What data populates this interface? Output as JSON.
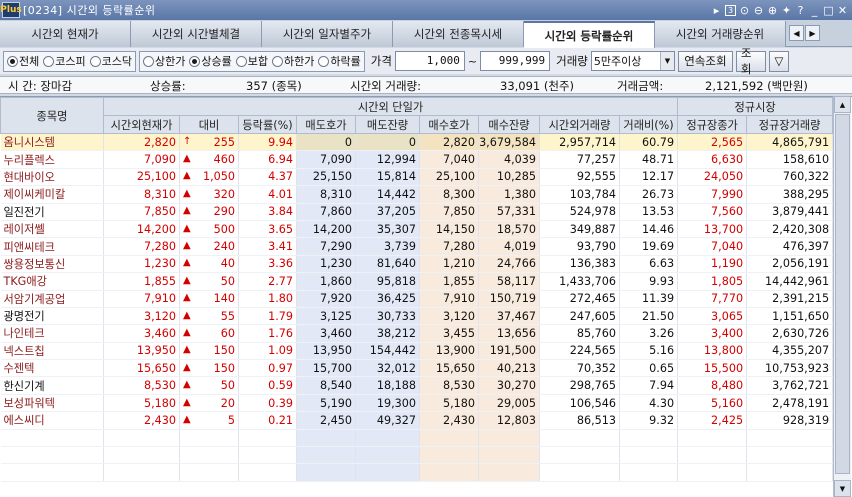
{
  "window": {
    "logo": "Plus",
    "title": "[0234] 시간외 등락률순위",
    "ctrl_num": "3",
    "icons": [
      "page-left-icon",
      "number-box-icon",
      "search-icon",
      "zoom-out-icon",
      "zoom-in-icon",
      "pin-icon",
      "help-icon",
      "minimize-icon",
      "maximize-icon",
      "close-icon"
    ]
  },
  "tabs": [
    {
      "label": "시간외 현재가"
    },
    {
      "label": "시간외 시간별체결"
    },
    {
      "label": "시간외 일자별주가"
    },
    {
      "label": "시간외 전종목시세"
    },
    {
      "label": "시간외 등락률순위",
      "active": true
    },
    {
      "label": "시간외 거래량순위"
    }
  ],
  "filters": {
    "market": [
      {
        "label": "전체",
        "checked": true
      },
      {
        "label": "코스피",
        "checked": false
      },
      {
        "label": "코스닥",
        "checked": false
      }
    ],
    "direction": [
      {
        "label": "상한가",
        "checked": false
      },
      {
        "label": "상승률",
        "checked": true
      },
      {
        "label": "보합",
        "checked": false
      },
      {
        "label": "하한가",
        "checked": false
      },
      {
        "label": "하락률",
        "checked": false
      }
    ],
    "price_label": "가격",
    "price_from": "1,000",
    "tilde": "~",
    "price_to": "999,999",
    "volume_label": "거래량",
    "volume_selected": "5만주이상",
    "continuous_btn": "연속조회",
    "query_btn": "조회"
  },
  "info": {
    "time_label": "시  간: 장마감",
    "rise_label": "상승률:",
    "rise_count": "357 (종목)",
    "volume_label": "시간외 거래량:",
    "volume_value": "33,091 (천주)",
    "amount_label": "거래금액:",
    "amount_value": "2,121,592 (백만원)"
  },
  "grid": {
    "header_group_after": "시간외 단일가",
    "header_group_regular": "정규시장",
    "columns": [
      "종목명",
      "시간외현재가",
      "대비",
      "등락률(%)",
      "매도호가",
      "매도잔량",
      "매수호가",
      "매수잔량",
      "시간외거래량",
      "거래비(%)",
      "정규장종가",
      "정규장거래량"
    ],
    "rows": [
      {
        "name": "옴니시스템",
        "price": "2,820",
        "arrow": "↑",
        "change": "255",
        "rate": "9.94",
        "ask": "0",
        "ask_qty": "0",
        "bid": "2,820",
        "bid_qty": "3,679,584",
        "vol": "2,957,714",
        "vol_ratio": "60.79",
        "close": "2,565",
        "close_vol": "4,865,791",
        "name_dark": false
      },
      {
        "name": "누리플렉스",
        "price": "7,090",
        "arrow": "▲",
        "change": "460",
        "rate": "6.94",
        "ask": "7,090",
        "ask_qty": "12,994",
        "bid": "7,040",
        "bid_qty": "4,039",
        "vol": "77,257",
        "vol_ratio": "48.71",
        "close": "6,630",
        "close_vol": "158,610",
        "name_dark": false
      },
      {
        "name": "현대바이오",
        "price": "25,100",
        "arrow": "▲",
        "change": "1,050",
        "rate": "4.37",
        "ask": "25,150",
        "ask_qty": "15,814",
        "bid": "25,100",
        "bid_qty": "10,285",
        "vol": "92,555",
        "vol_ratio": "12.17",
        "close": "24,050",
        "close_vol": "760,322",
        "name_dark": false
      },
      {
        "name": "제이씨케미칼",
        "price": "8,310",
        "arrow": "▲",
        "change": "320",
        "rate": "4.01",
        "ask": "8,310",
        "ask_qty": "14,442",
        "bid": "8,300",
        "bid_qty": "1,380",
        "vol": "103,784",
        "vol_ratio": "26.73",
        "close": "7,990",
        "close_vol": "388,295",
        "name_dark": false
      },
      {
        "name": "일진전기",
        "price": "7,850",
        "arrow": "▲",
        "change": "290",
        "rate": "3.84",
        "ask": "7,860",
        "ask_qty": "37,205",
        "bid": "7,850",
        "bid_qty": "57,331",
        "vol": "524,978",
        "vol_ratio": "13.53",
        "close": "7,560",
        "close_vol": "3,879,441",
        "name_dark": true
      },
      {
        "name": "레이저쎌",
        "price": "14,200",
        "arrow": "▲",
        "change": "500",
        "rate": "3.65",
        "ask": "14,200",
        "ask_qty": "35,307",
        "bid": "14,150",
        "bid_qty": "18,570",
        "vol": "349,887",
        "vol_ratio": "14.46",
        "close": "13,700",
        "close_vol": "2,420,308",
        "name_dark": false
      },
      {
        "name": "피앤씨테크",
        "price": "7,280",
        "arrow": "▲",
        "change": "240",
        "rate": "3.41",
        "ask": "7,290",
        "ask_qty": "3,739",
        "bid": "7,280",
        "bid_qty": "4,019",
        "vol": "93,790",
        "vol_ratio": "19.69",
        "close": "7,040",
        "close_vol": "476,397",
        "name_dark": false
      },
      {
        "name": "쌍용정보통신",
        "price": "1,230",
        "arrow": "▲",
        "change": "40",
        "rate": "3.36",
        "ask": "1,230",
        "ask_qty": "81,640",
        "bid": "1,210",
        "bid_qty": "24,766",
        "vol": "136,383",
        "vol_ratio": "6.63",
        "close": "1,190",
        "close_vol": "2,056,191",
        "name_dark": false
      },
      {
        "name": "TKG애강",
        "price": "1,855",
        "arrow": "▲",
        "change": "50",
        "rate": "2.77",
        "ask": "1,860",
        "ask_qty": "95,818",
        "bid": "1,855",
        "bid_qty": "58,117",
        "vol": "1,433,706",
        "vol_ratio": "9.93",
        "close": "1,805",
        "close_vol": "14,442,961",
        "name_dark": false
      },
      {
        "name": "서암기계공업",
        "price": "7,910",
        "arrow": "▲",
        "change": "140",
        "rate": "1.80",
        "ask": "7,920",
        "ask_qty": "36,425",
        "bid": "7,910",
        "bid_qty": "150,719",
        "vol": "272,465",
        "vol_ratio": "11.39",
        "close": "7,770",
        "close_vol": "2,391,215",
        "name_dark": false
      },
      {
        "name": "광명전기",
        "price": "3,120",
        "arrow": "▲",
        "change": "55",
        "rate": "1.79",
        "ask": "3,125",
        "ask_qty": "30,733",
        "bid": "3,120",
        "bid_qty": "37,467",
        "vol": "247,605",
        "vol_ratio": "21.50",
        "close": "3,065",
        "close_vol": "1,151,650",
        "name_dark": true
      },
      {
        "name": "나인테크",
        "price": "3,460",
        "arrow": "▲",
        "change": "60",
        "rate": "1.76",
        "ask": "3,460",
        "ask_qty": "38,212",
        "bid": "3,455",
        "bid_qty": "13,656",
        "vol": "85,760",
        "vol_ratio": "3.26",
        "close": "3,400",
        "close_vol": "2,630,726",
        "name_dark": false
      },
      {
        "name": "넥스트칩",
        "price": "13,950",
        "arrow": "▲",
        "change": "150",
        "rate": "1.09",
        "ask": "13,950",
        "ask_qty": "154,442",
        "bid": "13,900",
        "bid_qty": "191,500",
        "vol": "224,565",
        "vol_ratio": "5.16",
        "close": "13,800",
        "close_vol": "4,355,207",
        "name_dark": false
      },
      {
        "name": "수젠텍",
        "price": "15,650",
        "arrow": "▲",
        "change": "150",
        "rate": "0.97",
        "ask": "15,700",
        "ask_qty": "32,012",
        "bid": "15,650",
        "bid_qty": "40,213",
        "vol": "70,352",
        "vol_ratio": "0.65",
        "close": "15,500",
        "close_vol": "10,753,923",
        "name_dark": false
      },
      {
        "name": "한신기계",
        "price": "8,530",
        "arrow": "▲",
        "change": "50",
        "rate": "0.59",
        "ask": "8,540",
        "ask_qty": "18,188",
        "bid": "8,530",
        "bid_qty": "30,270",
        "vol": "298,765",
        "vol_ratio": "7.94",
        "close": "8,480",
        "close_vol": "3,762,721",
        "name_dark": true
      },
      {
        "name": "보성파워텍",
        "price": "5,180",
        "arrow": "▲",
        "change": "20",
        "rate": "0.39",
        "ask": "5,190",
        "ask_qty": "19,300",
        "bid": "5,180",
        "bid_qty": "29,005",
        "vol": "106,546",
        "vol_ratio": "4.30",
        "close": "5,160",
        "close_vol": "2,478,191",
        "name_dark": false
      },
      {
        "name": "에스씨디",
        "price": "2,430",
        "arrow": "▲",
        "change": "5",
        "rate": "0.21",
        "ask": "2,450",
        "ask_qty": "49,327",
        "bid": "2,430",
        "bid_qty": "12,803",
        "vol": "86,513",
        "vol_ratio": "9.32",
        "close": "2,425",
        "close_vol": "928,319",
        "name_dark": false
      }
    ],
    "empty_rows": 3
  }
}
